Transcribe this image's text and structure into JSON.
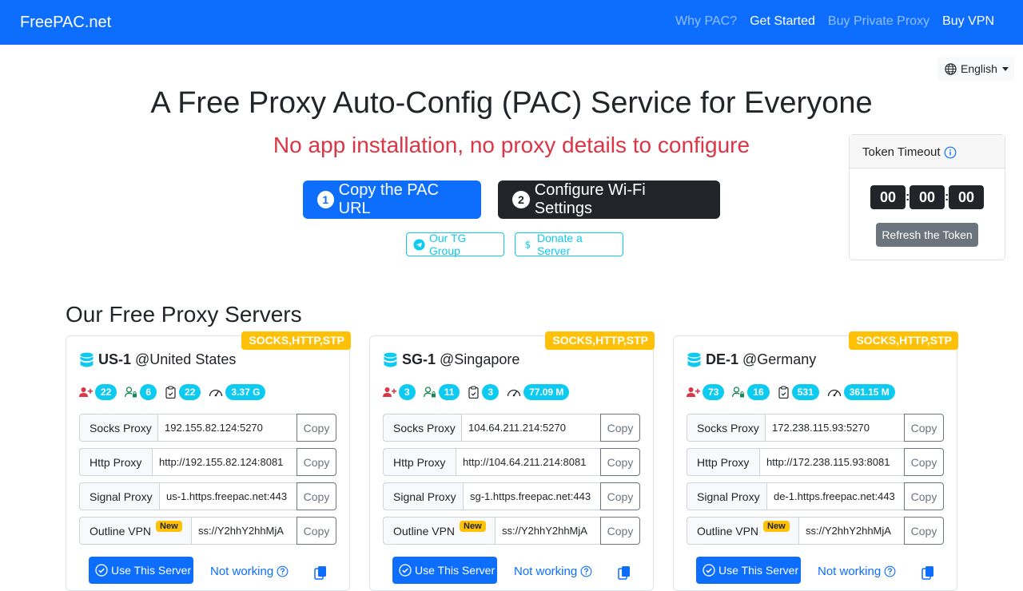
{
  "navbar": {
    "brand": "FreePAC.net",
    "links": [
      {
        "label": "Why PAC?",
        "active": false
      },
      {
        "label": "Get Started",
        "active": true
      },
      {
        "label": "Buy Private Proxy",
        "active": false
      },
      {
        "label": "Buy VPN",
        "active": false
      }
    ]
  },
  "language": {
    "selected": "English"
  },
  "hero": {
    "title": "A Free Proxy Auto-Config (PAC) Service for Everyone",
    "subtitle": "No app installation, no proxy details to configure",
    "btn_copy": {
      "num": "1",
      "label": "Copy the PAC URL"
    },
    "btn_wifi": {
      "num": "2",
      "label": "Configure Wi-Fi Settings"
    },
    "btn_tg": "Our TG Group",
    "btn_donate": "Donate a Server"
  },
  "token": {
    "title": "Token Timeout",
    "hours": "00",
    "minutes": "00",
    "seconds": "00",
    "refresh_label": "Refresh the Token"
  },
  "servers_section": {
    "title": "Our Free Proxy Servers"
  },
  "servers": [
    {
      "badge": "SOCKS,HTTP,STP",
      "name": "US-1",
      "location": "@United States",
      "stats": {
        "users": "22",
        "online": "6",
        "clipboard": "22",
        "traffic": "3.37 G"
      },
      "socks_label": "Socks Proxy",
      "socks": "192.155.82.124:5270",
      "http_label": "Http Proxy",
      "http": "http://192.155.82.124:8081",
      "signal_label": "Signal Proxy",
      "signal": "us-1.https.freepac.net:443",
      "outline_label": "Outline VPN",
      "outline_badge": "New",
      "outline": "ss://Y2hhY2hhMjA",
      "copy_label": "Copy",
      "use_label": "Use This Server",
      "not_working_label": "Not working"
    },
    {
      "badge": "SOCKS,HTTP,STP",
      "name": "SG-1",
      "location": "@Singapore",
      "stats": {
        "users": "3",
        "online": "11",
        "clipboard": "3",
        "traffic": "77.09 M"
      },
      "socks_label": "Socks Proxy",
      "socks": "104.64.211.214:5270",
      "http_label": "Http Proxy",
      "http": "http://104.64.211.214:8081",
      "signal_label": "Signal Proxy",
      "signal": "sg-1.https.freepac.net:443",
      "outline_label": "Outline VPN",
      "outline_badge": "New",
      "outline": "ss://Y2hhY2hhMjA",
      "copy_label": "Copy",
      "use_label": "Use This Server",
      "not_working_label": "Not working"
    },
    {
      "badge": "SOCKS,HTTP,STP",
      "name": "DE-1",
      "location": "@Germany",
      "stats": {
        "users": "73",
        "online": "16",
        "clipboard": "531",
        "traffic": "361.15 M"
      },
      "socks_label": "Socks Proxy",
      "socks": "172.238.115.93:5270",
      "http_label": "Http Proxy",
      "http": "http://172.238.115.93:8081",
      "signal_label": "Signal Proxy",
      "signal": "de-1.https.freepac.net:443",
      "outline_label": "Outline VPN",
      "outline_badge": "New",
      "outline": "ss://Y2hhY2hhMjA",
      "copy_label": "Copy",
      "use_label": "Use This Server",
      "not_working_label": "Not working"
    }
  ],
  "colors": {
    "primary": "#0d6efd",
    "danger": "#dc3545",
    "info": "#0dcaf0",
    "warning": "#ffc107",
    "dark": "#212529",
    "secondary": "#6c757d"
  }
}
